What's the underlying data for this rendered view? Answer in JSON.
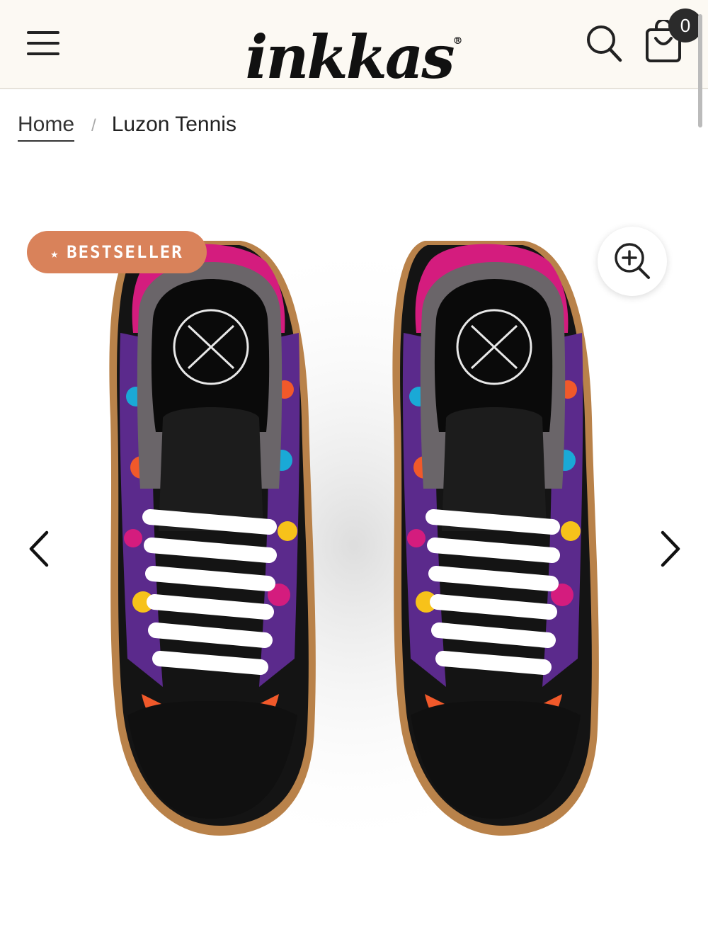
{
  "header": {
    "logo_text": "inkkas",
    "logo_mark": "®",
    "menu_icon": "hamburger-menu-icon",
    "search_icon": "search-icon",
    "cart_icon": "shopping-bag-icon",
    "cart_count": "0"
  },
  "breadcrumb": {
    "home_label": "Home",
    "separator": "/",
    "current_label": "Luzon Tennis"
  },
  "gallery": {
    "badge_star": "★",
    "badge_label": "BESTSELLER",
    "zoom_icon": "zoom-in-icon",
    "prev_icon": "chevron-left-icon",
    "next_icon": "chevron-right-icon",
    "image_alt": "Luzon Tennis"
  },
  "colors": {
    "header_bg": "#fcf9f3",
    "badge_bg": "#d9825a",
    "shoe_upper": "#141414",
    "collar_pink": "#d41c7e",
    "lining_grey": "#6a6569",
    "sole_gum": "#b9824a",
    "laces": "#ffffff"
  }
}
